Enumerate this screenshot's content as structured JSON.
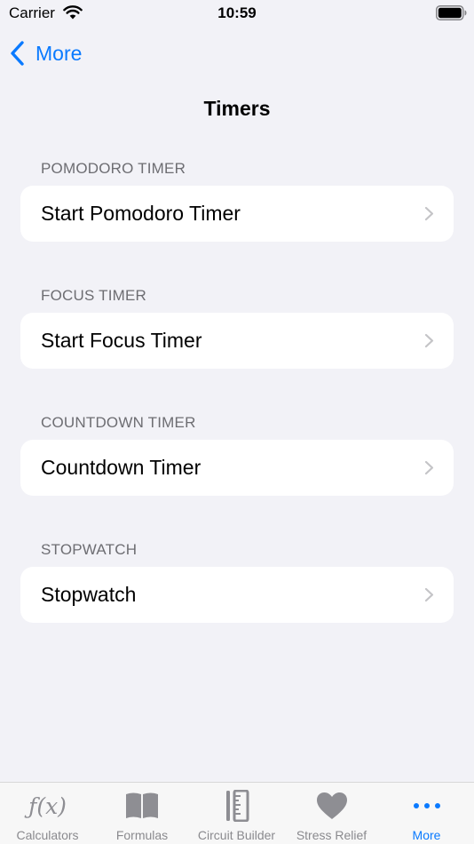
{
  "status_bar": {
    "carrier": "Carrier",
    "time": "10:59",
    "wifi_icon": "wifi-icon",
    "battery_icon": "battery-icon"
  },
  "nav": {
    "back_label": "More",
    "back_icon": "chevron-left-icon",
    "title": "Timers"
  },
  "sections": [
    {
      "header": "POMODORO TIMER",
      "item": "Start Pomodoro Timer"
    },
    {
      "header": "FOCUS TIMER",
      "item": "Start Focus Timer"
    },
    {
      "header": "COUNTDOWN TIMER",
      "item": "Countdown Timer"
    },
    {
      "header": "STOPWATCH",
      "item": "Stopwatch"
    }
  ],
  "tabs": [
    {
      "label": "Calculators",
      "icon": "function-icon",
      "glyph": "ƒ(x)"
    },
    {
      "label": "Formulas",
      "icon": "book-icon"
    },
    {
      "label": "Circuit Builder",
      "icon": "ruler-icon"
    },
    {
      "label": "Stress Relief",
      "icon": "heart-icon"
    },
    {
      "label": "More",
      "icon": "ellipsis-icon",
      "active": true
    }
  ],
  "colors": {
    "accent": "#0a7aff",
    "background": "#f2f2f7",
    "secondary_text": "#6d6d72",
    "inactive_tab": "#8e8e93"
  }
}
